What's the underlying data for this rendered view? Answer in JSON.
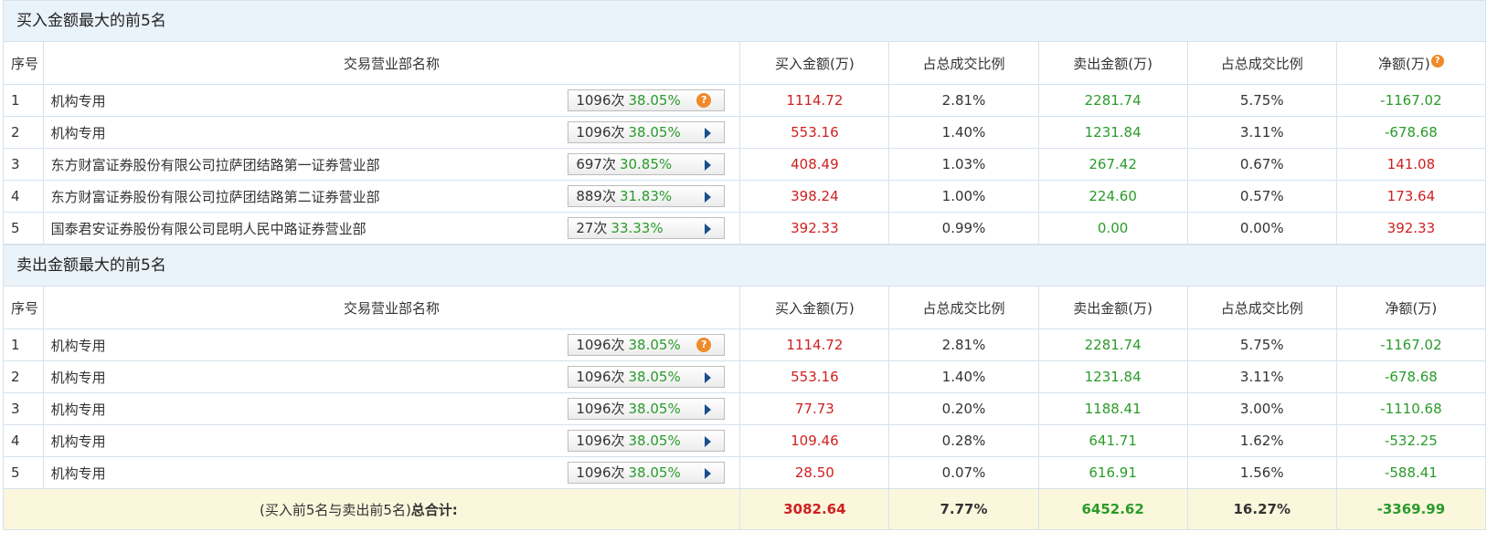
{
  "buy_section": {
    "title": "买入金额最大的前5名",
    "headers": [
      "序号",
      "交易营业部名称",
      "买入金额(万)",
      "占总成交比例",
      "卖出金额(万)",
      "占总成交比例",
      "净额(万)"
    ],
    "rows": [
      {
        "idx": "1",
        "name": "机构专用",
        "count": "1096次",
        "rate": "38.05%",
        "buy": "1114.72",
        "buy_pct": "2.81%",
        "sell": "2281.74",
        "sell_pct": "5.75%",
        "net": "-1167.02",
        "icon": "question"
      },
      {
        "idx": "2",
        "name": "机构专用",
        "count": "1096次",
        "rate": "38.05%",
        "buy": "553.16",
        "buy_pct": "1.40%",
        "sell": "1231.84",
        "sell_pct": "3.11%",
        "net": "-678.68",
        "icon": "arrow"
      },
      {
        "idx": "3",
        "name": "东方财富证券股份有限公司拉萨团结路第一证券营业部",
        "count": "697次",
        "rate": "30.85%",
        "buy": "408.49",
        "buy_pct": "1.03%",
        "sell": "267.42",
        "sell_pct": "0.67%",
        "net": "141.08",
        "icon": "arrow"
      },
      {
        "idx": "4",
        "name": "东方财富证券股份有限公司拉萨团结路第二证券营业部",
        "count": "889次",
        "rate": "31.83%",
        "buy": "398.24",
        "buy_pct": "1.00%",
        "sell": "224.60",
        "sell_pct": "0.57%",
        "net": "173.64",
        "icon": "arrow"
      },
      {
        "idx": "5",
        "name": "国泰君安证券股份有限公司昆明人民中路证券营业部",
        "count": "27次",
        "rate": "33.33%",
        "buy": "392.33",
        "buy_pct": "0.99%",
        "sell": "0.00",
        "sell_pct": "0.00%",
        "net": "392.33",
        "icon": "arrow"
      }
    ]
  },
  "sell_section": {
    "title": "卖出金额最大的前5名",
    "headers": [
      "序号",
      "交易营业部名称",
      "买入金额(万)",
      "占总成交比例",
      "卖出金额(万)",
      "占总成交比例",
      "净额(万)"
    ],
    "rows": [
      {
        "idx": "1",
        "name": "机构专用",
        "count": "1096次",
        "rate": "38.05%",
        "buy": "1114.72",
        "buy_pct": "2.81%",
        "sell": "2281.74",
        "sell_pct": "5.75%",
        "net": "-1167.02",
        "icon": "question"
      },
      {
        "idx": "2",
        "name": "机构专用",
        "count": "1096次",
        "rate": "38.05%",
        "buy": "553.16",
        "buy_pct": "1.40%",
        "sell": "1231.84",
        "sell_pct": "3.11%",
        "net": "-678.68",
        "icon": "arrow"
      },
      {
        "idx": "3",
        "name": "机构专用",
        "count": "1096次",
        "rate": "38.05%",
        "buy": "77.73",
        "buy_pct": "0.20%",
        "sell": "1188.41",
        "sell_pct": "3.00%",
        "net": "-1110.68",
        "icon": "arrow"
      },
      {
        "idx": "4",
        "name": "机构专用",
        "count": "1096次",
        "rate": "38.05%",
        "buy": "109.46",
        "buy_pct": "0.28%",
        "sell": "641.71",
        "sell_pct": "1.62%",
        "net": "-532.25",
        "icon": "arrow"
      },
      {
        "idx": "5",
        "name": "机构专用",
        "count": "1096次",
        "rate": "38.05%",
        "buy": "28.50",
        "buy_pct": "0.07%",
        "sell": "616.91",
        "sell_pct": "1.56%",
        "net": "-588.41",
        "icon": "arrow"
      }
    ]
  },
  "total": {
    "label_prefix": "(买入前5名与卖出前5名)",
    "label_bold": "总合计:",
    "buy": "3082.64",
    "buy_pct": "7.77%",
    "sell": "6452.62",
    "sell_pct": "16.27%",
    "net": "-3369.99"
  },
  "icons": {
    "question": "?"
  },
  "colors": {
    "positive": "#d01f1f",
    "negative": "#2a9b2a",
    "header_bg": "#eaf2fa",
    "total_bg": "#fbf7dc",
    "accent_icon": "#f08a2a"
  }
}
